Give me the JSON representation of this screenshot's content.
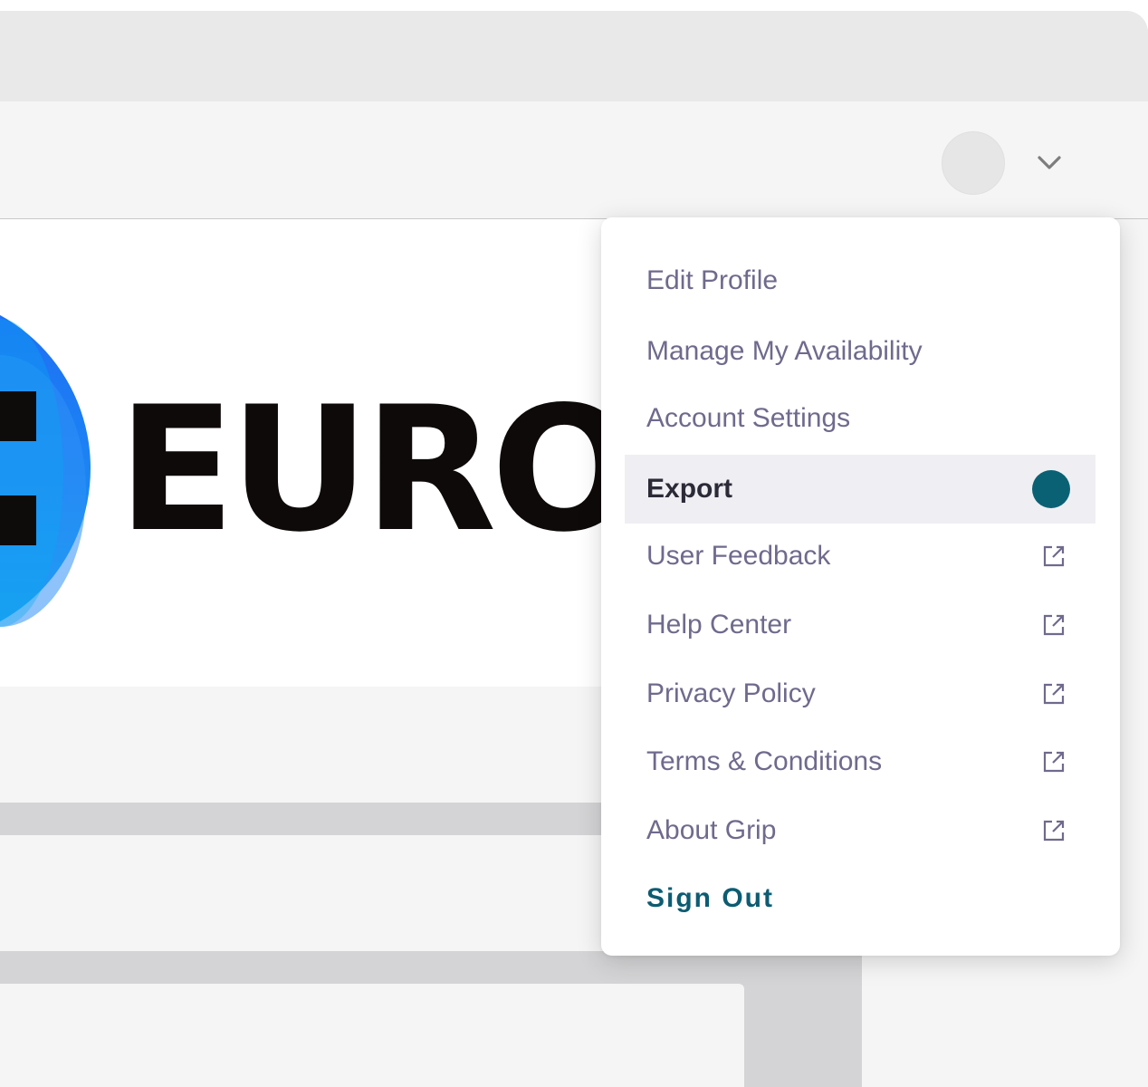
{
  "header": {
    "avatar_icon": "user-avatar-icon",
    "dropdown_icon": "chevron-down-icon"
  },
  "banner": {
    "logo_text": "EURO",
    "logo_icon": "blue-circle-logo-icon"
  },
  "menu": {
    "items": [
      {
        "label": "Edit Profile"
      },
      {
        "label": "Manage My Availability"
      },
      {
        "label": "Account Settings"
      },
      {
        "label": "Export",
        "active": true,
        "indicator": "status-dot"
      },
      {
        "label": "User Feedback",
        "icon": "external-link-icon"
      },
      {
        "label": "Help Center",
        "icon": "external-link-icon"
      },
      {
        "label": "Privacy Policy",
        "icon": "external-link-icon"
      },
      {
        "label": "Terms & Conditions",
        "icon": "external-link-icon"
      },
      {
        "label": "About Grip",
        "icon": "external-link-icon"
      },
      {
        "label": "Sign Out"
      }
    ]
  },
  "colors": {
    "accent": "#0d5c72",
    "status_dot": "#0b6174",
    "menu_text": "#6f6a8d",
    "active_text": "#2b2a37",
    "active_bg": "#efeff3"
  }
}
